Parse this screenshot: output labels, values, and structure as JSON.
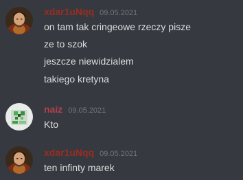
{
  "colors": {
    "background": "#36393f",
    "text": "#dcddde",
    "timestamp": "#72767d",
    "user1_name": "#992d22",
    "user2_name": "#b3414d"
  },
  "messages": [
    {
      "author": "xdar1uNqq",
      "timestamp": "09.05.2021",
      "avatar_icon": "portrait-avatar-icon",
      "lines": [
        "on tam tak cringeowe rzeczy pisze",
        "ze to szok",
        "jeszcze niewidzialem",
        "takiego kretyna"
      ]
    },
    {
      "author": "naiz",
      "timestamp": "09.05.2021",
      "avatar_icon": "pixel-art-avatar-icon",
      "lines": [
        "Kto"
      ]
    },
    {
      "author": "xdar1uNqq",
      "timestamp": "09.05.2021",
      "avatar_icon": "portrait-avatar-icon",
      "lines": [
        "ten infinty marek"
      ]
    }
  ]
}
